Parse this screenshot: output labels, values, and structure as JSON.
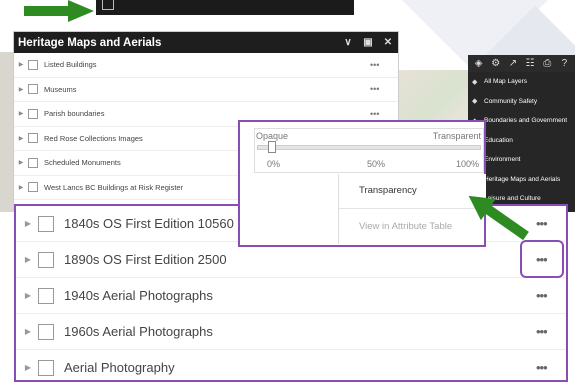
{
  "colors": {
    "accent_purple": "#8a4db5",
    "arrow_green": "#2e8b22",
    "header_dark": "#1e1e1e"
  },
  "widget": {
    "title": "Heritage Maps and Aerials",
    "header_icons": [
      "chevron-down-icon",
      "maximize-icon",
      "close-icon"
    ],
    "rows": [
      {
        "label": "Listed Buildings"
      },
      {
        "label": "Museums"
      },
      {
        "label": "Parish boundaries"
      },
      {
        "label": "Red Rose Collections Images"
      },
      {
        "label": "Scheduled Monuments"
      },
      {
        "label": "West Lancs BC Buildings at Risk Register"
      }
    ],
    "more_glyph": "•••"
  },
  "layer_menu": {
    "items": [
      {
        "label": "All Map Layers"
      },
      {
        "label": "Community Safety"
      },
      {
        "label": "Boundaries and Government"
      },
      {
        "label": "Education"
      },
      {
        "label": "Environment"
      },
      {
        "label": "Heritage Maps and Aerials"
      },
      {
        "label": "Leisure and Culture"
      }
    ]
  },
  "popup": {
    "opaque_label": "Opaque",
    "transparent_label": "Transparent",
    "tick_0": "0%",
    "tick_50": "50%",
    "tick_100": "100%",
    "transparency_value": 0.05,
    "menu": {
      "transparency": "Transparency",
      "view_attribute_table": "View in Attribute Table"
    }
  },
  "zoom_panel": {
    "rows": [
      {
        "label": "1840s OS First Edition 10560"
      },
      {
        "label": "1890s OS First Edition 2500"
      },
      {
        "label": "1940s Aerial Photographs"
      },
      {
        "label": "1960s Aerial Photographs"
      },
      {
        "label": "Aerial Photography"
      }
    ],
    "more_glyph": "•••"
  }
}
